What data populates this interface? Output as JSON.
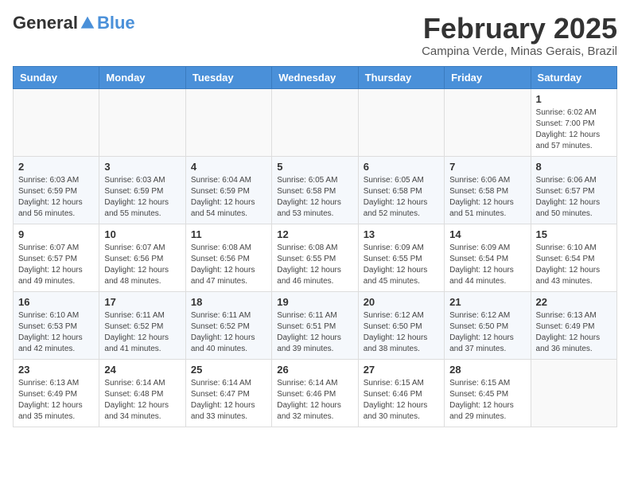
{
  "header": {
    "logo_general": "General",
    "logo_blue": "Blue",
    "main_title": "February 2025",
    "subtitle": "Campina Verde, Minas Gerais, Brazil"
  },
  "columns": [
    "Sunday",
    "Monday",
    "Tuesday",
    "Wednesday",
    "Thursday",
    "Friday",
    "Saturday"
  ],
  "weeks": [
    [
      {
        "day": "",
        "info": ""
      },
      {
        "day": "",
        "info": ""
      },
      {
        "day": "",
        "info": ""
      },
      {
        "day": "",
        "info": ""
      },
      {
        "day": "",
        "info": ""
      },
      {
        "day": "",
        "info": ""
      },
      {
        "day": "1",
        "info": "Sunrise: 6:02 AM\nSunset: 7:00 PM\nDaylight: 12 hours and 57 minutes."
      }
    ],
    [
      {
        "day": "2",
        "info": "Sunrise: 6:03 AM\nSunset: 6:59 PM\nDaylight: 12 hours and 56 minutes."
      },
      {
        "day": "3",
        "info": "Sunrise: 6:03 AM\nSunset: 6:59 PM\nDaylight: 12 hours and 55 minutes."
      },
      {
        "day": "4",
        "info": "Sunrise: 6:04 AM\nSunset: 6:59 PM\nDaylight: 12 hours and 54 minutes."
      },
      {
        "day": "5",
        "info": "Sunrise: 6:05 AM\nSunset: 6:58 PM\nDaylight: 12 hours and 53 minutes."
      },
      {
        "day": "6",
        "info": "Sunrise: 6:05 AM\nSunset: 6:58 PM\nDaylight: 12 hours and 52 minutes."
      },
      {
        "day": "7",
        "info": "Sunrise: 6:06 AM\nSunset: 6:58 PM\nDaylight: 12 hours and 51 minutes."
      },
      {
        "day": "8",
        "info": "Sunrise: 6:06 AM\nSunset: 6:57 PM\nDaylight: 12 hours and 50 minutes."
      }
    ],
    [
      {
        "day": "9",
        "info": "Sunrise: 6:07 AM\nSunset: 6:57 PM\nDaylight: 12 hours and 49 minutes."
      },
      {
        "day": "10",
        "info": "Sunrise: 6:07 AM\nSunset: 6:56 PM\nDaylight: 12 hours and 48 minutes."
      },
      {
        "day": "11",
        "info": "Sunrise: 6:08 AM\nSunset: 6:56 PM\nDaylight: 12 hours and 47 minutes."
      },
      {
        "day": "12",
        "info": "Sunrise: 6:08 AM\nSunset: 6:55 PM\nDaylight: 12 hours and 46 minutes."
      },
      {
        "day": "13",
        "info": "Sunrise: 6:09 AM\nSunset: 6:55 PM\nDaylight: 12 hours and 45 minutes."
      },
      {
        "day": "14",
        "info": "Sunrise: 6:09 AM\nSunset: 6:54 PM\nDaylight: 12 hours and 44 minutes."
      },
      {
        "day": "15",
        "info": "Sunrise: 6:10 AM\nSunset: 6:54 PM\nDaylight: 12 hours and 43 minutes."
      }
    ],
    [
      {
        "day": "16",
        "info": "Sunrise: 6:10 AM\nSunset: 6:53 PM\nDaylight: 12 hours and 42 minutes."
      },
      {
        "day": "17",
        "info": "Sunrise: 6:11 AM\nSunset: 6:52 PM\nDaylight: 12 hours and 41 minutes."
      },
      {
        "day": "18",
        "info": "Sunrise: 6:11 AM\nSunset: 6:52 PM\nDaylight: 12 hours and 40 minutes."
      },
      {
        "day": "19",
        "info": "Sunrise: 6:11 AM\nSunset: 6:51 PM\nDaylight: 12 hours and 39 minutes."
      },
      {
        "day": "20",
        "info": "Sunrise: 6:12 AM\nSunset: 6:50 PM\nDaylight: 12 hours and 38 minutes."
      },
      {
        "day": "21",
        "info": "Sunrise: 6:12 AM\nSunset: 6:50 PM\nDaylight: 12 hours and 37 minutes."
      },
      {
        "day": "22",
        "info": "Sunrise: 6:13 AM\nSunset: 6:49 PM\nDaylight: 12 hours and 36 minutes."
      }
    ],
    [
      {
        "day": "23",
        "info": "Sunrise: 6:13 AM\nSunset: 6:49 PM\nDaylight: 12 hours and 35 minutes."
      },
      {
        "day": "24",
        "info": "Sunrise: 6:14 AM\nSunset: 6:48 PM\nDaylight: 12 hours and 34 minutes."
      },
      {
        "day": "25",
        "info": "Sunrise: 6:14 AM\nSunset: 6:47 PM\nDaylight: 12 hours and 33 minutes."
      },
      {
        "day": "26",
        "info": "Sunrise: 6:14 AM\nSunset: 6:46 PM\nDaylight: 12 hours and 32 minutes."
      },
      {
        "day": "27",
        "info": "Sunrise: 6:15 AM\nSunset: 6:46 PM\nDaylight: 12 hours and 30 minutes."
      },
      {
        "day": "28",
        "info": "Sunrise: 6:15 AM\nSunset: 6:45 PM\nDaylight: 12 hours and 29 minutes."
      },
      {
        "day": "",
        "info": ""
      }
    ]
  ]
}
